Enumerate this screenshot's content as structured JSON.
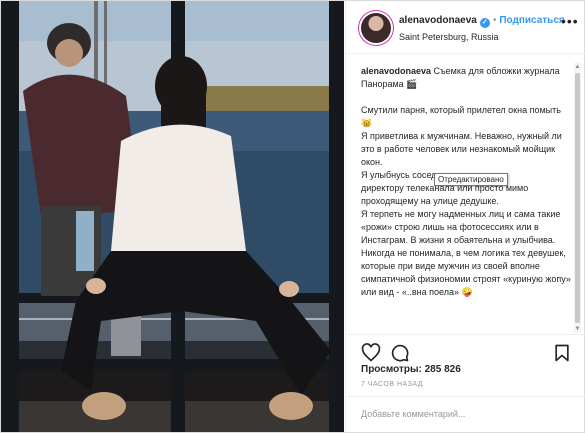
{
  "post": {
    "username": "alenavodonaeva",
    "verified_glyph": "✓",
    "separator": "•",
    "follow_label": "Подписаться",
    "location": "Saint Petersburg, Russia",
    "more_glyph": "•••"
  },
  "caption": {
    "username": "alenavodonaeva",
    "line1": "Съемка для обложки журнала Панорама 🎬",
    "paragraph1": "Смутили парня, который прилетел окна помыть 😸",
    "paragraph2a": "Я приветлива к мужчинам. Неважно, нужный ли это в работе человек или незнакомый мойщик окон.",
    "paragraph2b": "Я улыбнусь соседу, с",
    "paragraph2c": "директору телеканала или просто мимо проходящему на улице дедушке.",
    "paragraph3": "Я терпеть не могу надменных лиц и сама такие «рожи» строю лишь на фотосессиях или в Инстаграм. В жизни я обаятельна и улыбчива.",
    "paragraph4": "Никогда не понимала, в чем логика тех девушек, которые при виде мужчин из своей вполне симпатичной физиономии строят «куриную жопу» или вид - «..вна поела» 🤪",
    "tooltip": "Отредактировано"
  },
  "icons": {
    "like": "heart-icon",
    "comment": "comment-icon",
    "save": "bookmark-icon"
  },
  "stats": {
    "views_label": "Просмотры:",
    "views_value": "285 826",
    "time_ago": "7 ЧАСОВ НАЗАД"
  },
  "composer": {
    "placeholder": "Добавьте комментарий..."
  },
  "colors": {
    "accent": "#3897f0",
    "text": "#262626",
    "muted": "#999999",
    "border": "#efefef"
  }
}
